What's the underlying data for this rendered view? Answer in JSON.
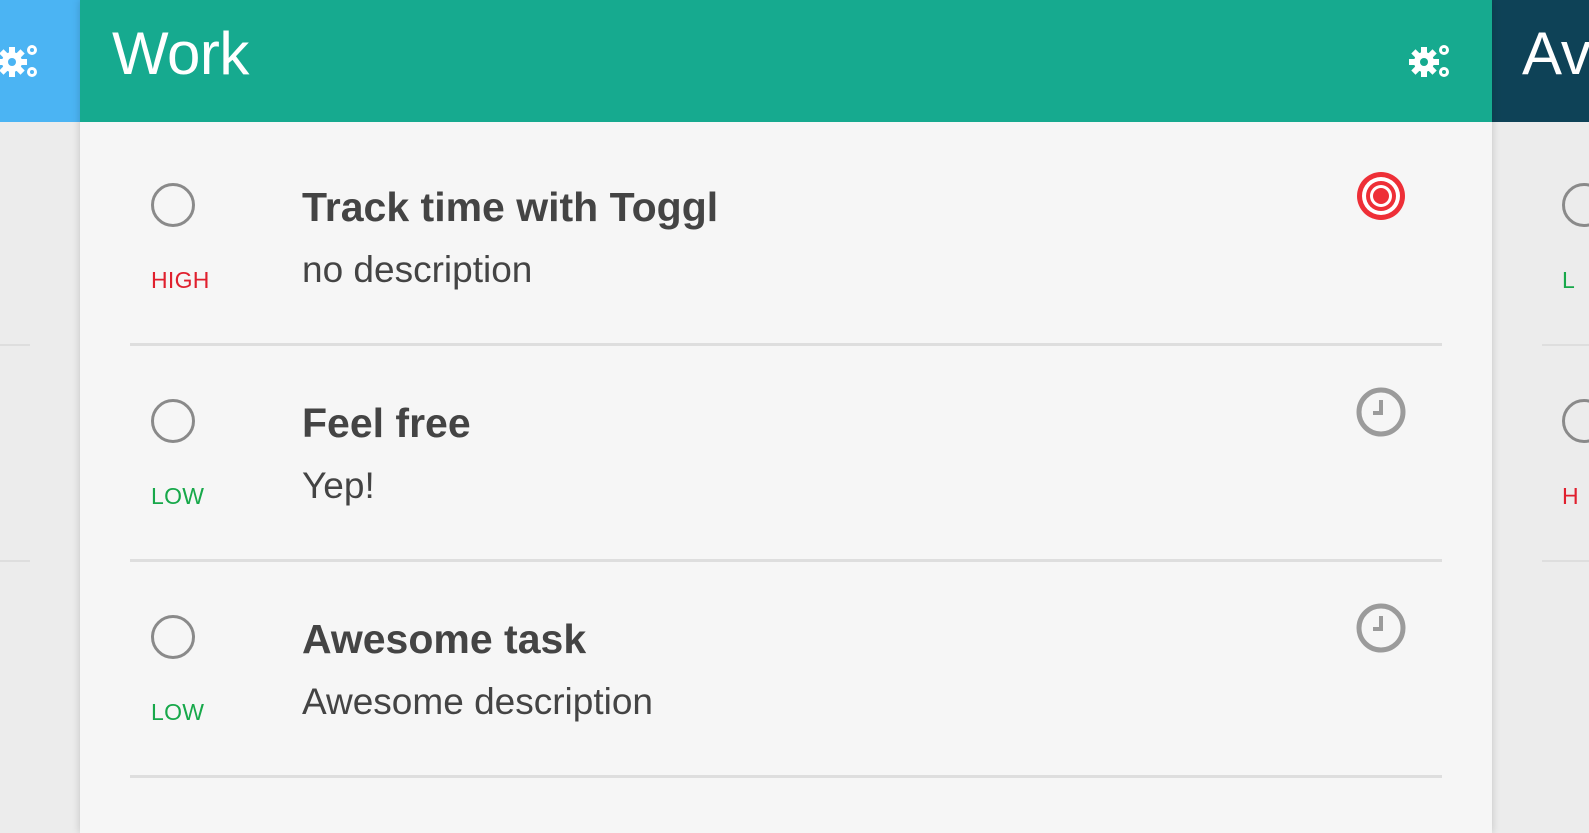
{
  "left_column": {
    "settings_icon": "gears-icon",
    "header_color": "#4bb4f3"
  },
  "main_column": {
    "title": "Work",
    "header_color": "#16aa8f",
    "settings_icon": "gears-icon",
    "tasks": [
      {
        "name": "Track time with Toggl",
        "description": "no description",
        "priority": "HIGH",
        "priority_color": "#e0202e",
        "status_icon": "target-icon",
        "status_color": "#ee2f37"
      },
      {
        "name": "Feel free",
        "description": "Yep!",
        "priority": "LOW",
        "priority_color": "#17a84a",
        "status_icon": "clock-icon",
        "status_color": "#9b9b9b"
      },
      {
        "name": "Awesome task",
        "description": "Awesome description",
        "priority": "LOW",
        "priority_color": "#17a84a",
        "status_icon": "clock-icon",
        "status_color": "#9b9b9b"
      }
    ]
  },
  "right_column": {
    "title_partial": "Av",
    "header_color": "#0e4257",
    "priorities_partial": [
      "L",
      "H"
    ]
  }
}
